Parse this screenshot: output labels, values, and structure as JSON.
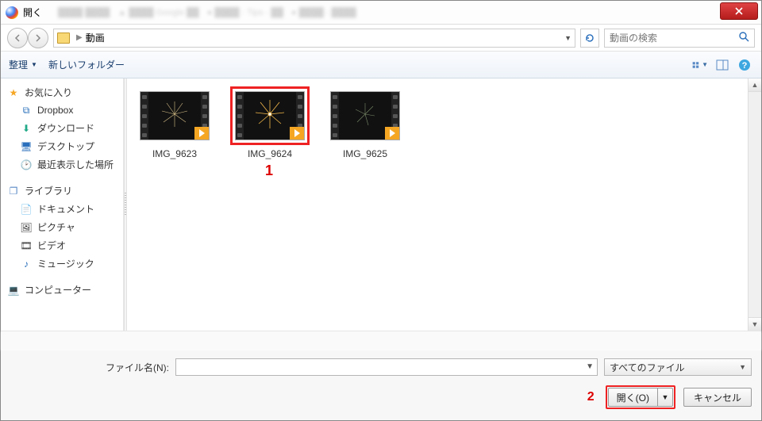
{
  "title": "開く",
  "address": {
    "folder": "動画"
  },
  "search": {
    "placeholder": "動画の検索"
  },
  "toolbar": {
    "organize": "整理",
    "newfolder": "新しいフォルダー"
  },
  "sidebar": {
    "fav_header": "お気に入り",
    "fav": [
      {
        "label": "Dropbox"
      },
      {
        "label": "ダウンロード"
      },
      {
        "label": "デスクトップ"
      },
      {
        "label": "最近表示した場所"
      }
    ],
    "lib_header": "ライブラリ",
    "lib": [
      {
        "label": "ドキュメント"
      },
      {
        "label": "ピクチャ"
      },
      {
        "label": "ビデオ"
      },
      {
        "label": "ミュージック"
      }
    ],
    "computer_header": "コンピューター"
  },
  "files": [
    {
      "name": "IMG_9623"
    },
    {
      "name": "IMG_9624"
    },
    {
      "name": "IMG_9625"
    }
  ],
  "footer": {
    "filename_label": "ファイル名(N):",
    "filter": "すべてのファイル",
    "open": "開く(O)",
    "cancel": "キャンセル"
  },
  "annotations": {
    "one": "1",
    "two": "2"
  }
}
